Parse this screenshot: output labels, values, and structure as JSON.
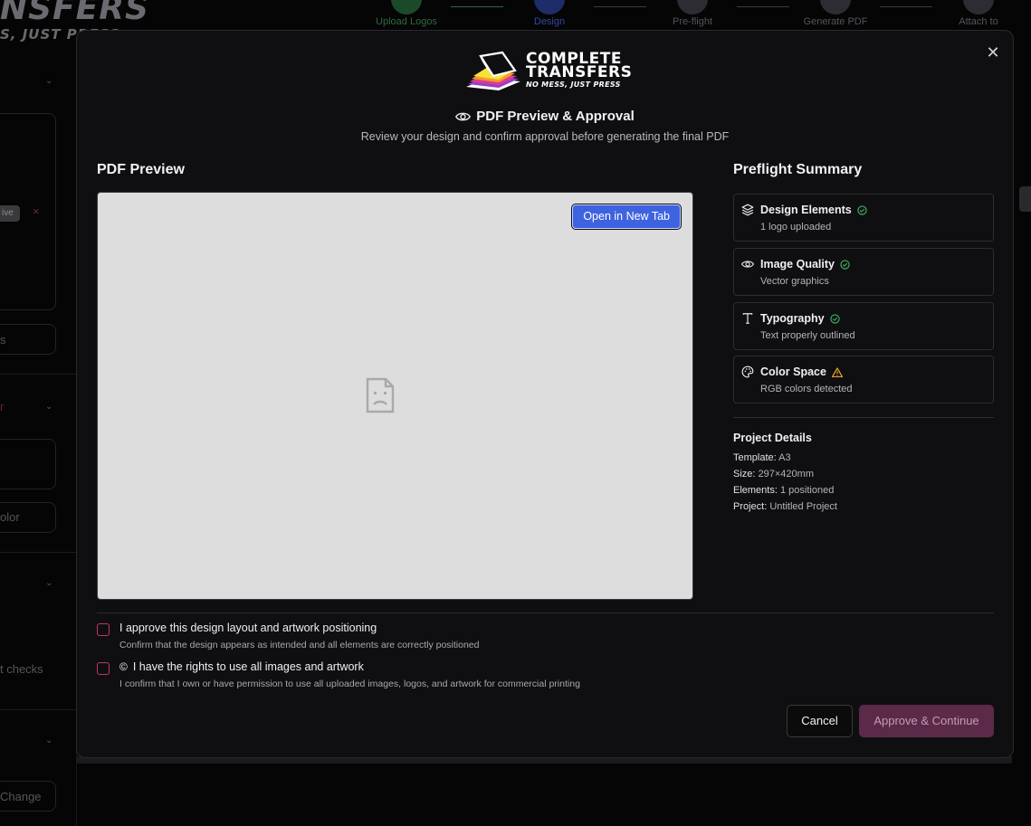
{
  "background": {
    "brand_big": "NSFERS",
    "brand_small": "S, JUST PRESS",
    "steps": [
      {
        "label": "Upload Logos",
        "state": "done"
      },
      {
        "label": "Design",
        "state": "active"
      },
      {
        "label": "Pre-flight",
        "state": "pending"
      },
      {
        "label": "Generate PDF",
        "state": "pending"
      },
      {
        "label": "Attach to",
        "state": "pending"
      }
    ],
    "side_texts": [
      "ive",
      "s",
      "r",
      "olor",
      "t checks",
      "Change"
    ]
  },
  "modal": {
    "brand": {
      "line1": "COMPLETE",
      "line2": "TRANSFERS",
      "line3": "NO MESS, JUST PRESS"
    },
    "title": "PDF Preview & Approval",
    "title_icon": "eye-icon",
    "subtitle": "Review your design and confirm approval before generating the final PDF",
    "close_icon": "close-icon",
    "pdf_preview": {
      "heading": "PDF Preview",
      "open_tab_label": "Open in New Tab",
      "placeholder_icon": "broken-document-icon"
    },
    "preflight": {
      "heading": "Preflight Summary",
      "items": [
        {
          "title": "Design Elements",
          "subtitle": "1 logo uploaded",
          "icon": "layers-icon",
          "status": "ok"
        },
        {
          "title": "Image Quality",
          "subtitle": "Vector graphics",
          "icon": "eye-icon",
          "status": "ok"
        },
        {
          "title": "Typography",
          "subtitle": "Text properly outlined",
          "icon": "text-icon",
          "status": "ok"
        },
        {
          "title": "Color Space",
          "subtitle": "RGB colors detected",
          "icon": "palette-icon",
          "status": "warning"
        }
      ],
      "status_colors": {
        "ok": "#3fb764",
        "warning": "#e0a028"
      }
    },
    "project_details": {
      "heading": "Project Details",
      "rows": [
        {
          "label": "Template:",
          "value": "A3"
        },
        {
          "label": "Size:",
          "value": "297×420mm"
        },
        {
          "label": "Elements:",
          "value": "1 positioned"
        },
        {
          "label": "Project:",
          "value": "Untitled Project"
        }
      ]
    },
    "approvals": [
      {
        "label": "I approve this design layout and artwork positioning",
        "desc": "Confirm that the design appears as intended and all elements are correctly positioned",
        "checked": false
      },
      {
        "label": "I have the rights to use all images and artwork",
        "desc": "I confirm that I own or have permission to use all uploaded images, logos, and artwork for commercial printing",
        "checked": false,
        "icon": "copyright-icon"
      }
    ],
    "buttons": {
      "cancel": "Cancel",
      "approve": "Approve & Continue"
    },
    "accent": "#c4336f",
    "primary": "#3e63e0"
  }
}
